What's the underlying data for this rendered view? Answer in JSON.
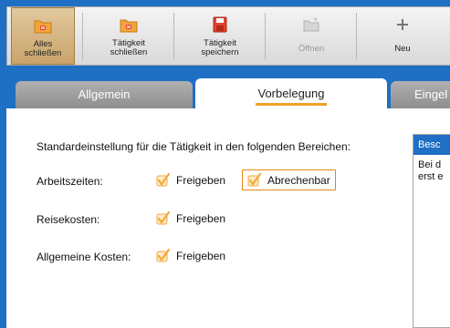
{
  "toolbar": {
    "buttons": [
      {
        "label": "Alles schließen",
        "icon": "folder-close-all-icon",
        "state": "active"
      },
      {
        "label": "Tätigkeit schließen",
        "icon": "folder-close-icon",
        "state": "normal"
      },
      {
        "label": "Tätigkeit speichern",
        "icon": "save-icon",
        "state": "normal"
      },
      {
        "label": "Öffnen",
        "icon": "open-icon",
        "state": "disabled"
      },
      {
        "label": "Neu",
        "icon": "plus-icon",
        "state": "normal"
      }
    ]
  },
  "tabs": [
    {
      "label": "Allgemein",
      "selected": false
    },
    {
      "label": "Vorbelegung",
      "selected": true
    },
    {
      "label": "Eingel",
      "selected": false
    }
  ],
  "panel": {
    "heading": "Standardeinstellung für die Tätigkeit in den folgenden Bereichen:",
    "rows": [
      {
        "label": "Arbeitszeiten:",
        "options": [
          {
            "label": "Freigeben",
            "checked": true
          },
          {
            "label": "Abrechenbar",
            "checked": true,
            "focused": true
          }
        ]
      },
      {
        "label": "Reisekosten:",
        "options": [
          {
            "label": "Freigeben",
            "checked": true
          }
        ]
      },
      {
        "label": "Allgemeine Kosten:",
        "options": [
          {
            "label": "Freigeben",
            "checked": true
          }
        ]
      }
    ]
  },
  "description": {
    "title": "Besc",
    "lines": [
      "Bei d",
      "erst e"
    ]
  },
  "colors": {
    "background": "#1F6FC4",
    "accent": "#F0A22A",
    "check": "#F4A93A"
  }
}
